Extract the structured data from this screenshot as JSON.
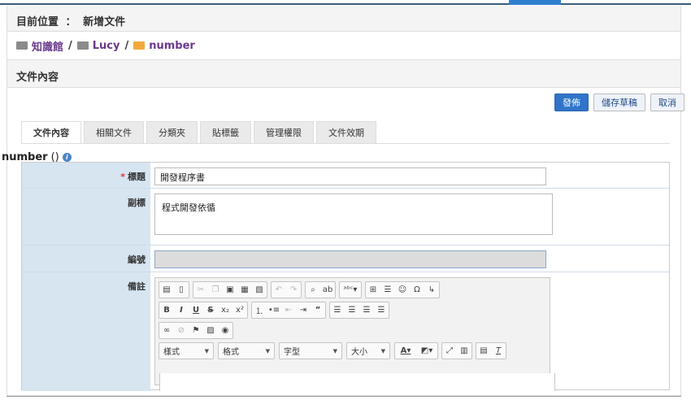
{
  "location": {
    "label": "目前位置",
    "sep": "：",
    "page": "新增文件"
  },
  "breadcrumb": {
    "items": [
      "知識館",
      "Lucy",
      "number"
    ],
    "separator": "/"
  },
  "section": {
    "title": "文件內容"
  },
  "actions": {
    "publish": "發佈",
    "save_draft": "儲存草稿",
    "cancel": "取消"
  },
  "tabs": [
    "文件內容",
    "相關文件",
    "分類夾",
    "貼標籤",
    "管理權限",
    "文件效期"
  ],
  "doc_type": {
    "name": "number",
    "suffix": "()"
  },
  "form": {
    "title_label": "標題",
    "title_value": "開發程序書",
    "subtitle_label": "副標",
    "subtitle_value": "程式開發依循",
    "number_label": "編號",
    "number_value": "",
    "note_label": "備註"
  },
  "editor": {
    "row1": [
      "source-icon",
      "new-page-icon",
      "cut-icon",
      "copy-icon",
      "paste-icon",
      "paste-text-icon",
      "paste-word-icon",
      "undo-icon",
      "redo-icon",
      "find-icon",
      "replace-icon",
      "spellcheck-icon",
      "table-icon",
      "horizontal-rule-icon",
      "smiley-icon",
      "special-char-icon",
      "page-break-icon"
    ],
    "combos": {
      "styles": "樣式",
      "format": "格式",
      "font": "字型",
      "size": "大小"
    }
  }
}
